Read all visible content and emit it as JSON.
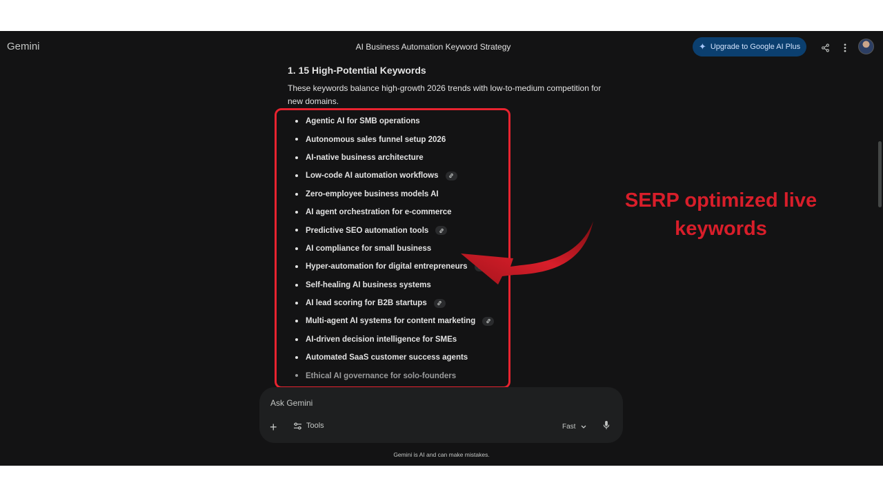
{
  "app": {
    "brand": "Gemini",
    "conversation_title": "AI Business Automation Keyword Strategy"
  },
  "header": {
    "upgrade_label": "Upgrade to Google AI Plus"
  },
  "section": {
    "heading": "1. 15 High-Potential Keywords",
    "intro": "These keywords balance high-growth 2026 trends with low-to-medium competition for new domains."
  },
  "keywords": [
    {
      "label": "Agentic AI for SMB operations",
      "link": false
    },
    {
      "label": "Autonomous sales funnel setup 2026",
      "link": false
    },
    {
      "label": "AI-native business architecture",
      "link": false
    },
    {
      "label": "Low-code AI automation workflows",
      "link": true
    },
    {
      "label": "Zero-employee business models AI",
      "link": false
    },
    {
      "label": "AI agent orchestration for e-commerce",
      "link": false
    },
    {
      "label": "Predictive SEO automation tools",
      "link": true
    },
    {
      "label": "AI compliance for small business",
      "link": false
    },
    {
      "label": "Hyper-automation for digital entrepreneurs",
      "link": true
    },
    {
      "label": "Self-healing AI business systems",
      "link": false
    },
    {
      "label": "AI lead scoring for B2B startups",
      "link": true
    },
    {
      "label": "Multi-agent AI systems for content marketing",
      "link": true
    },
    {
      "label": "AI-driven decision intelligence for SMEs",
      "link": false
    },
    {
      "label": "Automated SaaS customer success agents",
      "link": false
    },
    {
      "label": "Ethical AI governance for solo-founders",
      "link": false
    }
  ],
  "annotation": {
    "line1": "SERP optimized live",
    "line2": "keywords",
    "color": "#d81e2a"
  },
  "composer": {
    "placeholder": "Ask Gemini",
    "tools_label": "Tools",
    "mode_label": "Fast"
  },
  "footer": {
    "disclaimer": "Gemini is AI and can make mistakes."
  },
  "icons": {
    "upgrade": "sparkle-icon",
    "share": "share-icon",
    "more": "more-vert-icon",
    "link": "link-icon",
    "add": "plus-icon",
    "tools": "tune-icon",
    "dropdown": "chevron-down-icon",
    "mic": "mic-icon"
  }
}
